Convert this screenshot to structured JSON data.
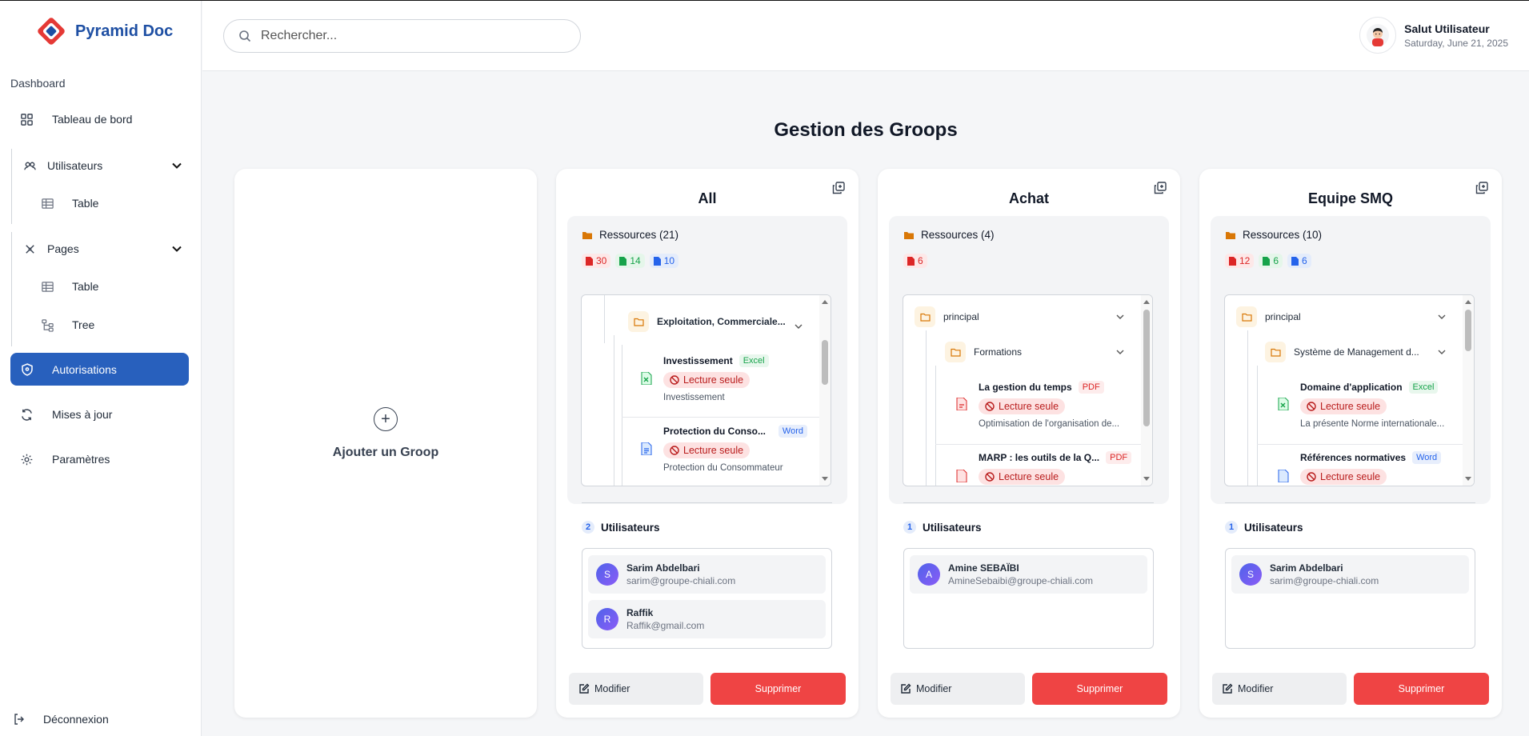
{
  "brand": {
    "name": "Pyramid Doc"
  },
  "sidebar": {
    "section_label": "Dashboard",
    "dashboard": "Tableau de bord",
    "users": {
      "label": "Utilisateurs",
      "sub": "Table"
    },
    "pages": {
      "label": "Pages",
      "sub1": "Table",
      "sub2": "Tree"
    },
    "autorisations": "Autorisations",
    "updates": "Mises à jour",
    "settings": "Paramètres",
    "logout": "Déconnexion"
  },
  "header": {
    "search_placeholder": "Rechercher...",
    "greeting": "Salut Utilisateur",
    "date": "Saturday, June 21, 2025"
  },
  "page": {
    "title": "Gestion des Groops",
    "add_label": "Ajouter un Groop"
  },
  "common": {
    "modify": "Modifier",
    "delete": "Supprimer",
    "users_label": "Utilisateurs",
    "read_only": "Lecture seule"
  },
  "colors": {
    "accent": "#2860bd",
    "danger": "#ef4444",
    "pdf": "#dc2626",
    "excel": "#16a34a",
    "word": "#2563eb",
    "folder": "#f59e0b"
  },
  "groups": [
    {
      "title": "All",
      "resources": "Ressources (21)",
      "counts": {
        "pdf": "30",
        "excel": "14",
        "word": "10"
      },
      "tree": {
        "folder": "Exploitation, Commerciale...",
        "files": [
          {
            "name": "Investissement",
            "type": "Excel",
            "desc": "Investissement"
          },
          {
            "name": "Protection du Conso...",
            "type": "Word",
            "desc": "Protection du Consommateur"
          }
        ]
      },
      "user_count": "2",
      "users": [
        {
          "initial": "S",
          "name": "Sarim Abdelbari",
          "email": "sarim@groupe-chiali.com"
        },
        {
          "initial": "R",
          "name": "Raffik",
          "email": "Raffik@gmail.com"
        }
      ]
    },
    {
      "title": "Achat",
      "resources": "Ressources (4)",
      "counts": {
        "pdf": "6"
      },
      "tree": {
        "root": "principal",
        "folder": "Formations",
        "files": [
          {
            "name": "La gestion du temps",
            "type": "PDF",
            "desc": "Optimisation de l'organisation de..."
          },
          {
            "name": "MARP : les outils de la Q...",
            "type": "PDF"
          }
        ]
      },
      "user_count": "1",
      "users": [
        {
          "initial": "A",
          "name": "Amine SEBAÏBI",
          "email": "AmineSebaibi@groupe-chiali.com"
        }
      ]
    },
    {
      "title": "Equipe SMQ",
      "resources": "Ressources (10)",
      "counts": {
        "pdf": "12",
        "excel": "6",
        "word": "6"
      },
      "tree": {
        "root": "principal",
        "folder": "Système de Management d...",
        "files": [
          {
            "name": "Domaine d'application",
            "type": "Excel",
            "desc": "La présente Norme internationale..."
          },
          {
            "name": "Références normatives",
            "type": "Word"
          }
        ]
      },
      "user_count": "1",
      "users": [
        {
          "initial": "S",
          "name": "Sarim Abdelbari",
          "email": "sarim@groupe-chiali.com"
        }
      ]
    }
  ]
}
